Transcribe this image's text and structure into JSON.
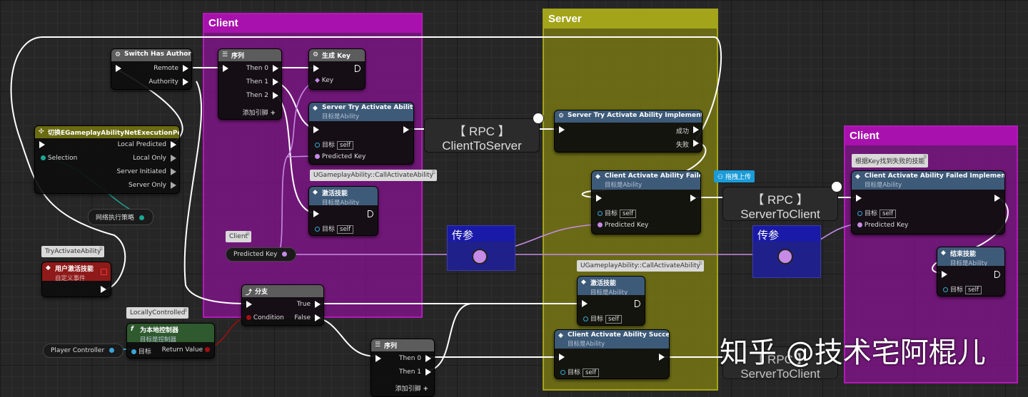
{
  "comments": {
    "client1": "Client",
    "server": "Server",
    "client2": "Client"
  },
  "switch_authority": {
    "title": "Switch Has Authority",
    "remote": "Remote",
    "authority": "Authority"
  },
  "sequence1": {
    "title": "序列",
    "then0": "Then 0",
    "then1": "Then 1",
    "then2": "Then 2",
    "add_pin": "添加引脚"
  },
  "gen_key": {
    "title": "生成 Key",
    "key": "Key"
  },
  "server_try_activate": {
    "title": "Server Try Activate Ability",
    "subtitle": "目标是Ability",
    "target": "目标",
    "self": "self",
    "predicted_key": "Predicted Key"
  },
  "switch_policy": {
    "title": "切换EGameplayAbilityNetExecutionPolicy",
    "selection": "Selection",
    "local_predicted": "Local Predicted",
    "local_only": "Local Only",
    "server_initiated": "Server Initiated",
    "server_only": "Server Only"
  },
  "policy_var": "网络执行策略",
  "rpc_client_to_server": {
    "line1": "【 RPC 】",
    "line2": "ClientToServer"
  },
  "server_impl": {
    "title": "Server Try Activate Ability Implementation",
    "success": "成功",
    "fail": "失败"
  },
  "client_failed": {
    "title": "Client Activate Ability Failed",
    "subtitle": "目标是Ability",
    "target": "目标",
    "self": "self",
    "predicted_key": "Predicted Key"
  },
  "tag_call_activate_1": "UGameplayAbility::CallActivateAbility",
  "activate_1": {
    "title": "激活技能",
    "subtitle": "目标是Ability",
    "target": "目标",
    "self": "self"
  },
  "client_tag": "Client",
  "predicted_key_var": "Predicted Key",
  "try_activate_tag": "TryActivateAbility",
  "custom_event": {
    "title": "用户激活技能",
    "subtitle": "自定义事件"
  },
  "chuancan_1": "传参",
  "chuancan_2": "传参",
  "drag_upload": "拖拽上传",
  "rpc_server_to_client": {
    "line1": "【 RPC 】",
    "line2": "ServerToClient"
  },
  "rpc_server_to_client_2": {
    "line1": "【 RPC 】",
    "line2": "ServerToClient"
  },
  "client2_tag": "根据Key找到失败的技能",
  "client_failed_impl": {
    "title": "Client Activate Ability Failed Implementation",
    "subtitle": "目标是Ability",
    "target": "目标",
    "self": "self",
    "predicted_key": "Predicted Key"
  },
  "end_ability": {
    "title": "结束技能",
    "subtitle": "目标是Ability",
    "target": "目标",
    "self": "self"
  },
  "branch": {
    "title": "分支",
    "true": "True",
    "false": "False",
    "condition": "Condition"
  },
  "locally_controlled_tag": "LocallyControlled",
  "is_local": {
    "title": "为本地控制器",
    "subtitle": "目标是控制器",
    "target": "目标",
    "return_value": "Return Value"
  },
  "player_controller_var": "Player Controller",
  "tag_call_activate_2": "UGameplayAbility::CallActivateAbility",
  "activate_2": {
    "title": "激活技能",
    "subtitle": "目标是Ability",
    "target": "目标",
    "self": "self"
  },
  "client_succeed": {
    "title": "Client Activate Ability Succeed",
    "subtitle": "目标是Ability",
    "target": "目标",
    "self": "self"
  },
  "sequence2": {
    "title": "序列",
    "then0": "Then 0",
    "then1": "Then 1",
    "add_pin": "添加引脚"
  },
  "watermark": "知乎 @技术宅阿棍儿",
  "colors": {
    "client_comment": "#8b0e8e",
    "server_comment": "#7b7b12",
    "exec_wire": "#ffffff",
    "key_wire": "#c58be6",
    "node_blue_header": "#3d5a78",
    "object_pin": "#39a6d6",
    "bool_pin": "#a01010"
  }
}
